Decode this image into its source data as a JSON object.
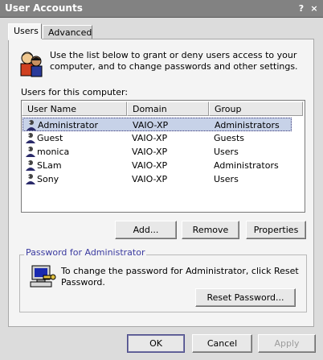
{
  "window": {
    "title": "User Accounts",
    "help_label": "?",
    "close_label": "×"
  },
  "tabs": [
    {
      "label": "Users",
      "active": true
    },
    {
      "label": "Advanced",
      "active": false
    }
  ],
  "intro": {
    "text": "Use the list below to grant or deny users access to your computer, and to change passwords and other settings."
  },
  "users_section": {
    "label": "Users for this computer:",
    "columns": [
      "User Name",
      "Domain",
      "Group"
    ],
    "rows": [
      {
        "name": "Administrator",
        "domain": "VAIO-XP",
        "group": "Administrators",
        "selected": true
      },
      {
        "name": "Guest",
        "domain": "VAIO-XP",
        "group": "Guests",
        "selected": false
      },
      {
        "name": "monica",
        "domain": "VAIO-XP",
        "group": "Users",
        "selected": false
      },
      {
        "name": "SLam",
        "domain": "VAIO-XP",
        "group": "Administrators",
        "selected": false
      },
      {
        "name": "Sony",
        "domain": "VAIO-XP",
        "group": "Users",
        "selected": false
      }
    ]
  },
  "list_buttons": {
    "add": "Add...",
    "remove": "Remove",
    "properties": "Properties"
  },
  "password_group": {
    "label": "Password for Administrator",
    "text": "To change the password for Administrator, click Reset Password.",
    "reset_button": "Reset Password..."
  },
  "dialog_buttons": {
    "ok": "OK",
    "cancel": "Cancel",
    "apply": "Apply"
  },
  "colors": {
    "titlebar": "#828282",
    "selection": "#c7d2e8",
    "group_label": "#3a3aa0"
  }
}
